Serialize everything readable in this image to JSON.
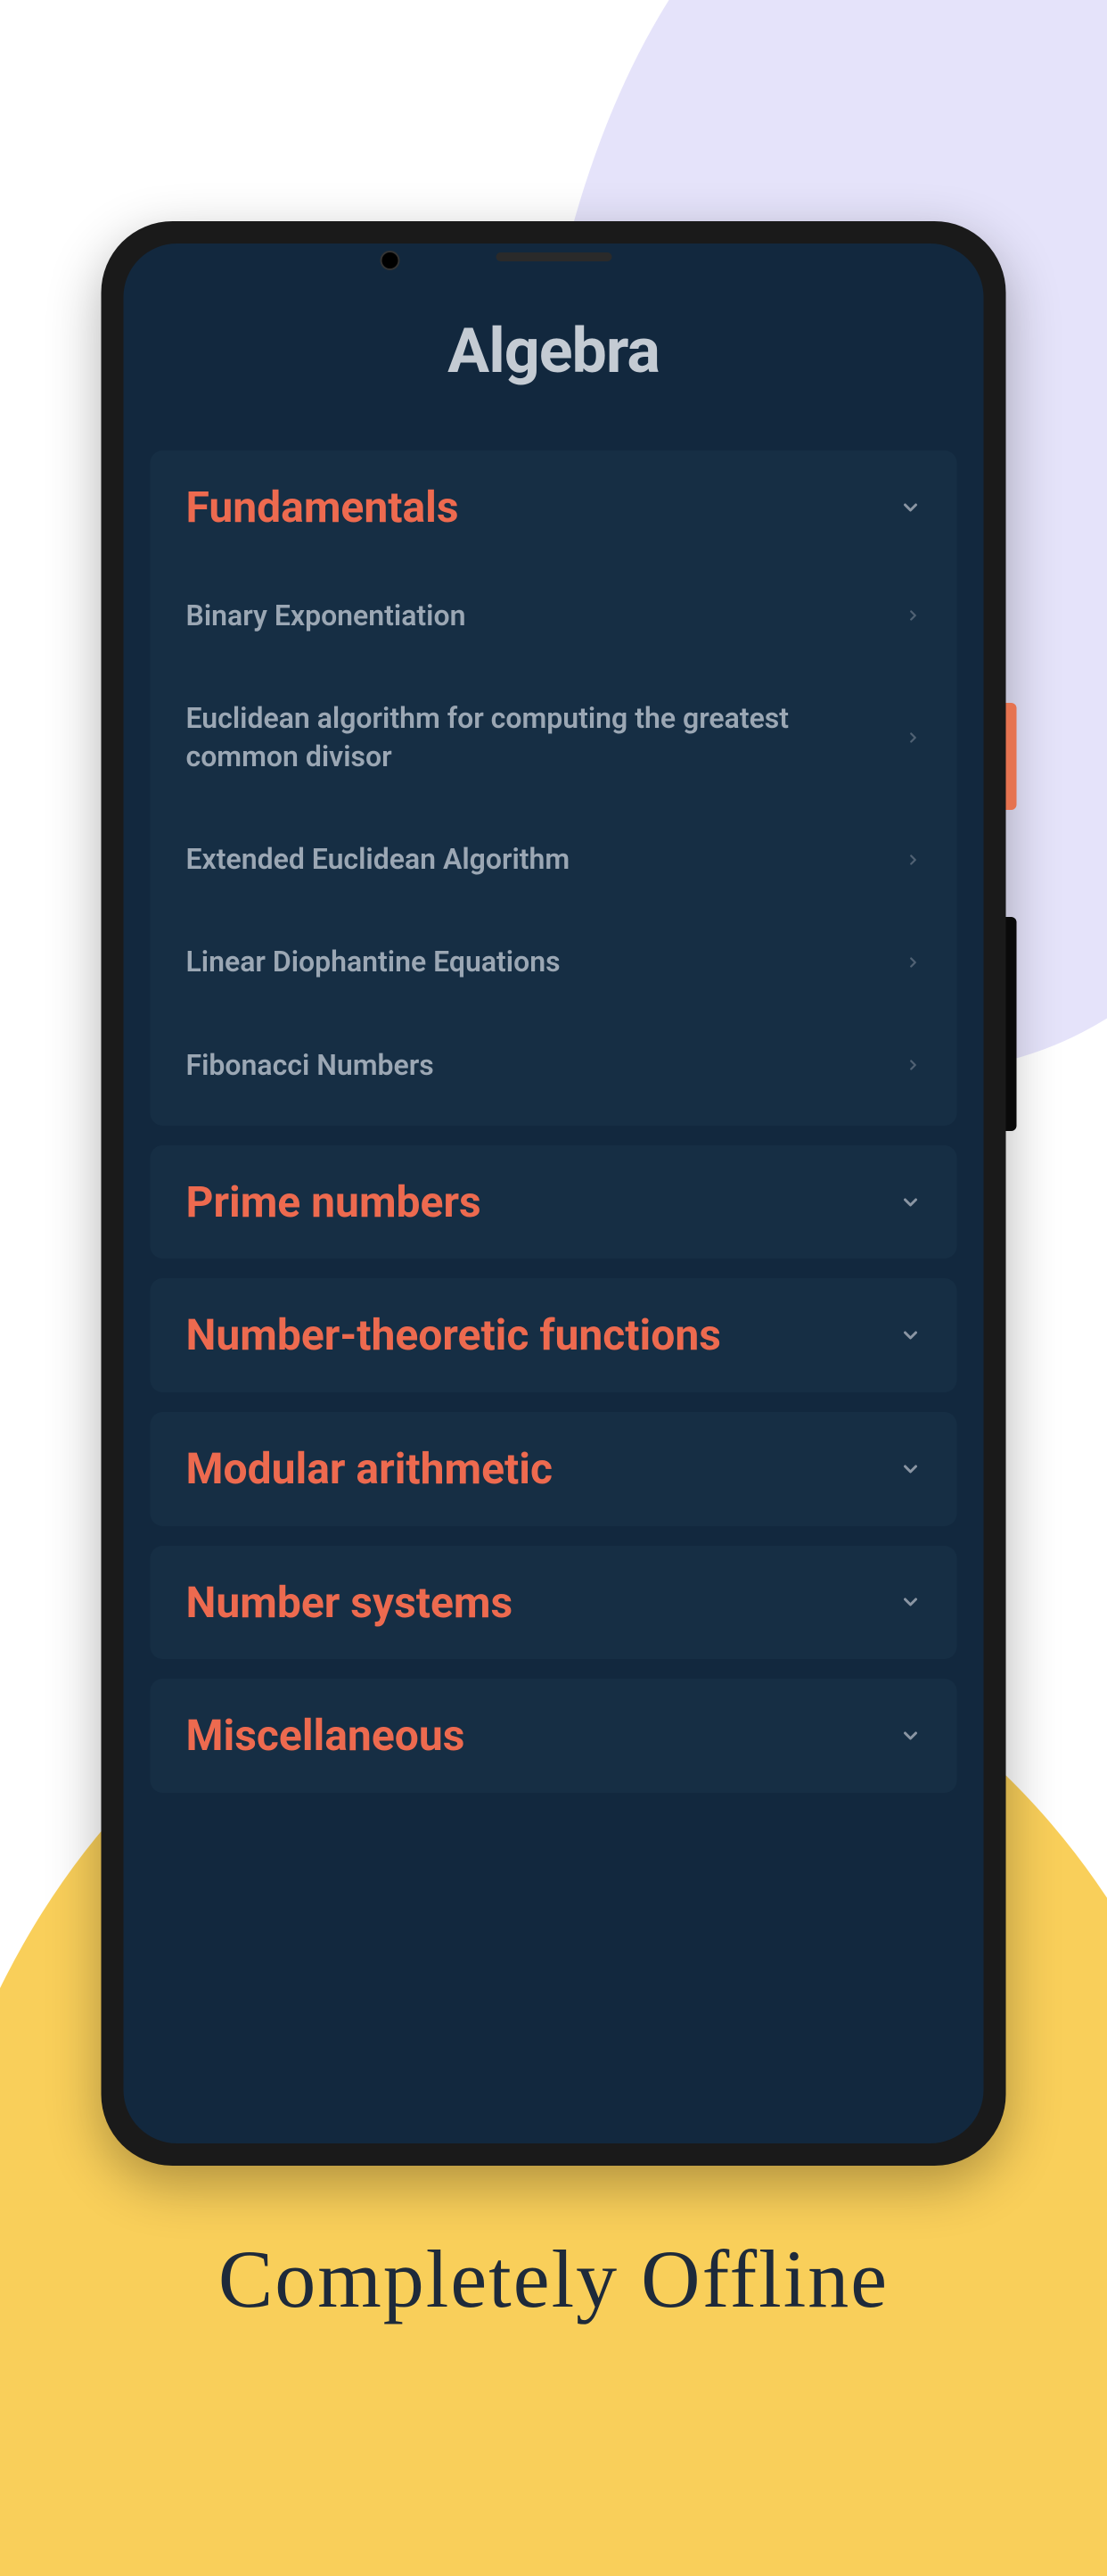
{
  "page_title": "Algebra",
  "tagline": "Completely Offline",
  "sections": [
    {
      "title": "Fundamentals",
      "expanded": true,
      "items": [
        "Binary Exponentiation",
        "Euclidean algorithm for computing the greatest common divisor",
        "Extended Euclidean Algorithm",
        "Linear Diophantine Equations",
        "Fibonacci Numbers"
      ]
    },
    {
      "title": "Prime numbers",
      "expanded": false
    },
    {
      "title": "Number-theoretic functions",
      "expanded": false
    },
    {
      "title": "Modular arithmetic",
      "expanded": false
    },
    {
      "title": "Number systems",
      "expanded": false
    },
    {
      "title": "Miscellaneous",
      "expanded": false
    }
  ]
}
